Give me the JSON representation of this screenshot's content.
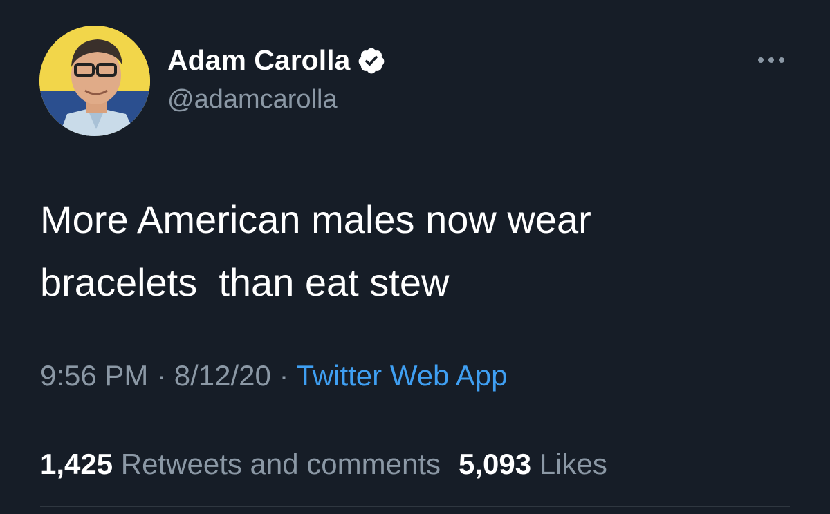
{
  "tweet": {
    "author": {
      "name": "Adam Carolla",
      "handle": "@adamcarolla",
      "verified_icon": "verified-badge-icon",
      "avatar_bg": "#f2d64a"
    },
    "more_icon": "more-options-icon",
    "text_line1": "More American males now wear",
    "text_line2": "bracelets  than eat stew",
    "time": "9:56 PM",
    "separator": " · ",
    "date": "8/12/20",
    "source": "Twitter Web App",
    "retweets_count": "1,425",
    "retweets_label": "Retweets and comments",
    "likes_count": "5,093",
    "likes_label": "Likes"
  },
  "colors": {
    "background": "#161d27",
    "text_primary": "#ffffff",
    "text_secondary": "#8b98a5",
    "link": "#3f9ff2",
    "divider": "#2f3740"
  }
}
